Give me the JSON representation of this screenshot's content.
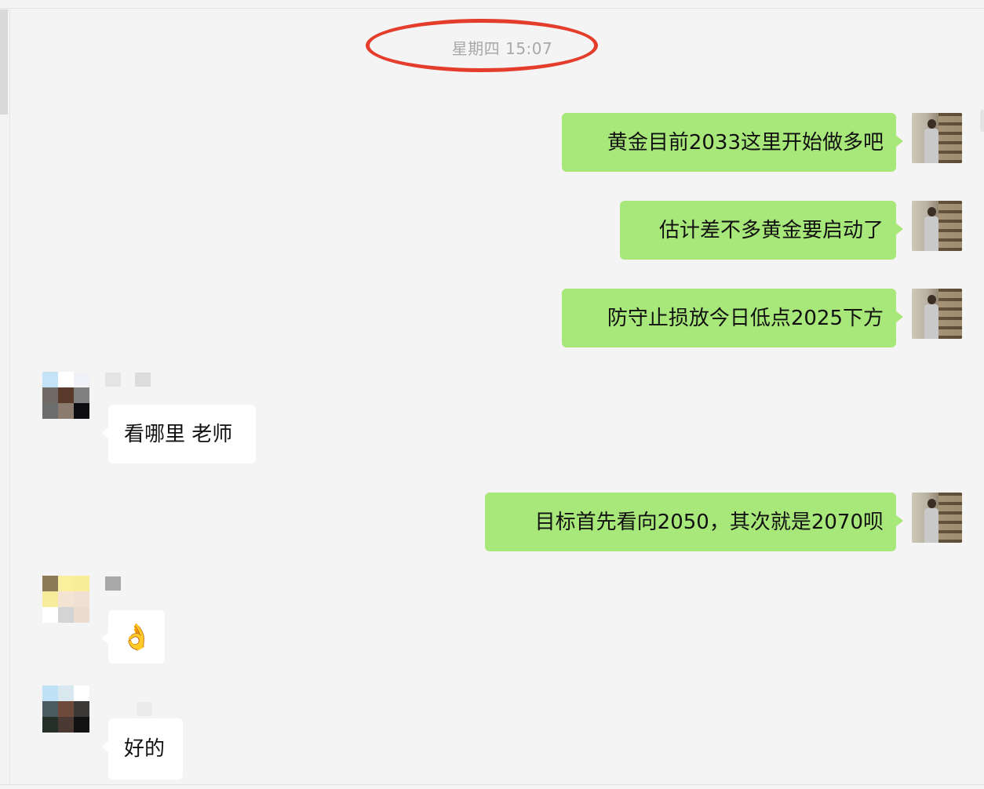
{
  "timestamp": "星期四 15:07",
  "messages": {
    "m1": "黄金目前2033这里开始做多吧",
    "m2": "估计差不多黄金要启动了",
    "m3": "防守止损放今日低点2025下方",
    "m4": "看哪里 老师",
    "m5": "目标首先看向2050，其次就是2070呗",
    "m6": "👌",
    "m7": "好的"
  },
  "colors": {
    "my_bubble": "#a8e87a",
    "other_bubble": "#ffffff",
    "annotation_oval": "#e53d2c",
    "timestamp_text": "#a9a9a9"
  },
  "icons": {
    "my_avatar": "user-photo-avatar",
    "contact_avatar": "pixelated-avatar"
  }
}
